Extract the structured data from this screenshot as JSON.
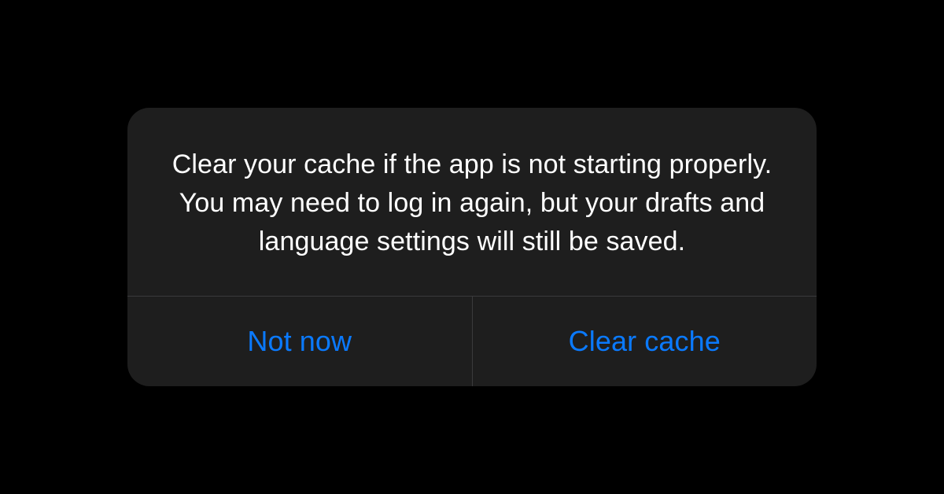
{
  "dialog": {
    "message": "Clear your cache if the app is not starting properly. You may need to log in again, but your drafts and language settings will still be saved.",
    "buttons": {
      "cancel_label": "Not now",
      "confirm_label": "Clear cache"
    }
  }
}
